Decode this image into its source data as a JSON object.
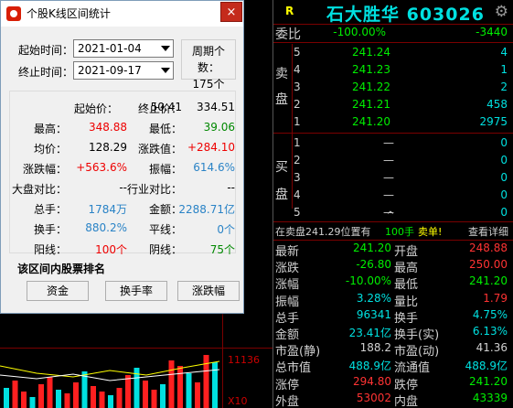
{
  "dialog": {
    "title": "个股K线区间统计",
    "close_label": "×",
    "start_date_label": "起始时间：",
    "start_date_value": "2021-01-04",
    "end_date_label": "终止时间：",
    "end_date_value": "2021-09-17",
    "period_label": "周期个数：",
    "period_value": "175个",
    "stats": {
      "start_price_label": "起始价：",
      "start_price": "50.41",
      "end_price_label": "终止价：",
      "end_price": "334.51",
      "high_label": "最高：",
      "high": "348.88",
      "low_label": "最低：",
      "low": "39.06",
      "avg_label": "均价：",
      "avg": "128.29",
      "change_label": "涨跌值：",
      "change": "+284.10",
      "change_pct_label": "涨跌幅：",
      "change_pct": "+563.6%",
      "amplitude_label": "振幅：",
      "amplitude": "614.6%",
      "market_cmp_label": "大盘对比：",
      "market_cmp": "--",
      "industry_cmp_label": "行业对比：",
      "industry_cmp": "--",
      "volume_label": "总手：",
      "volume": "1784万",
      "amount_label": "金额：",
      "amount": "2288.71亿",
      "turnover_label": "换手：",
      "turnover": "880.2%",
      "flat_label": "平线：",
      "flat": "0个",
      "up_label": "阳线：",
      "up": "100个",
      "down_label": "阴线：",
      "down": "75个"
    },
    "rank_title": "该区间内股票排名",
    "buttons": [
      "资金",
      "换手率",
      "涨跌幅"
    ]
  },
  "chart": {
    "axis_labels": [
      "11136",
      "X10"
    ]
  },
  "quote": {
    "market_tag": "R",
    "stock_name": "石大胜华 603026",
    "gear_icon": "⚙",
    "weibi_label": "委比",
    "weibi_pct": "-100.00%",
    "weibi_diff": "-3440",
    "sell_side_label": [
      "卖",
      "盘"
    ],
    "buy_side_label": [
      "买",
      "盘"
    ],
    "sell": [
      {
        "level": "5",
        "price": "241.24",
        "vol": "4"
      },
      {
        "level": "4",
        "price": "241.23",
        "vol": "1"
      },
      {
        "level": "3",
        "price": "241.22",
        "vol": "2"
      },
      {
        "level": "2",
        "price": "241.21",
        "vol": "458"
      },
      {
        "level": "1",
        "price": "241.20",
        "vol": "2975"
      }
    ],
    "buy": [
      {
        "level": "1",
        "price": "—",
        "vol": "0"
      },
      {
        "level": "2",
        "price": "—",
        "vol": "0"
      },
      {
        "level": "3",
        "price": "—",
        "vol": "0"
      },
      {
        "level": "4",
        "price": "—",
        "vol": "0"
      },
      {
        "level": "5",
        "price": "—",
        "vol": "0"
      }
    ],
    "collapse_arrow": "^",
    "notice_prefix": "在卖盘241.29位置有",
    "notice_qty": "100手",
    "notice_suffix": "卖单!",
    "detail_link": "查看详细",
    "fields": [
      {
        "l": "最新",
        "v": "241.20",
        "c": "gg",
        "l2": "开盘",
        "v2": "248.88",
        "c2": "rr"
      },
      {
        "l": "涨跌",
        "v": "-26.80",
        "c": "gg",
        "l2": "最高",
        "v2": "250.00",
        "c2": "rr"
      },
      {
        "l": "涨幅",
        "v": "-10.00%",
        "c": "gg",
        "l2": "最低",
        "v2": "241.20",
        "c2": "gg"
      },
      {
        "l": "振幅",
        "v": "3.28%",
        "c": "cy",
        "l2": "量比",
        "v2": "1.79",
        "c2": "rr"
      },
      {
        "l": "总手",
        "v": "96341",
        "c": "cy",
        "l2": "换手",
        "v2": "4.75%",
        "c2": "cy"
      },
      {
        "l": "金额",
        "v": "23.41亿",
        "c": "cy",
        "l2": "换手(实)",
        "v2": "6.13%",
        "c2": "cy"
      },
      {
        "l": "市盈(静)",
        "v": "188.2",
        "c": "w",
        "l2": "市盈(动)",
        "v2": "41.36",
        "c2": "w"
      },
      {
        "l": "总市值",
        "v": "488.9亿",
        "c": "cy",
        "l2": "流通值",
        "v2": "488.9亿",
        "c2": "cy"
      },
      {
        "l": "涨停",
        "v": "294.80",
        "c": "rr",
        "l2": "跌停",
        "v2": "241.20",
        "c2": "gg"
      },
      {
        "l": "外盘",
        "v": "53002",
        "c": "rr",
        "l2": "内盘",
        "v2": "43339",
        "c2": "gg"
      }
    ]
  }
}
